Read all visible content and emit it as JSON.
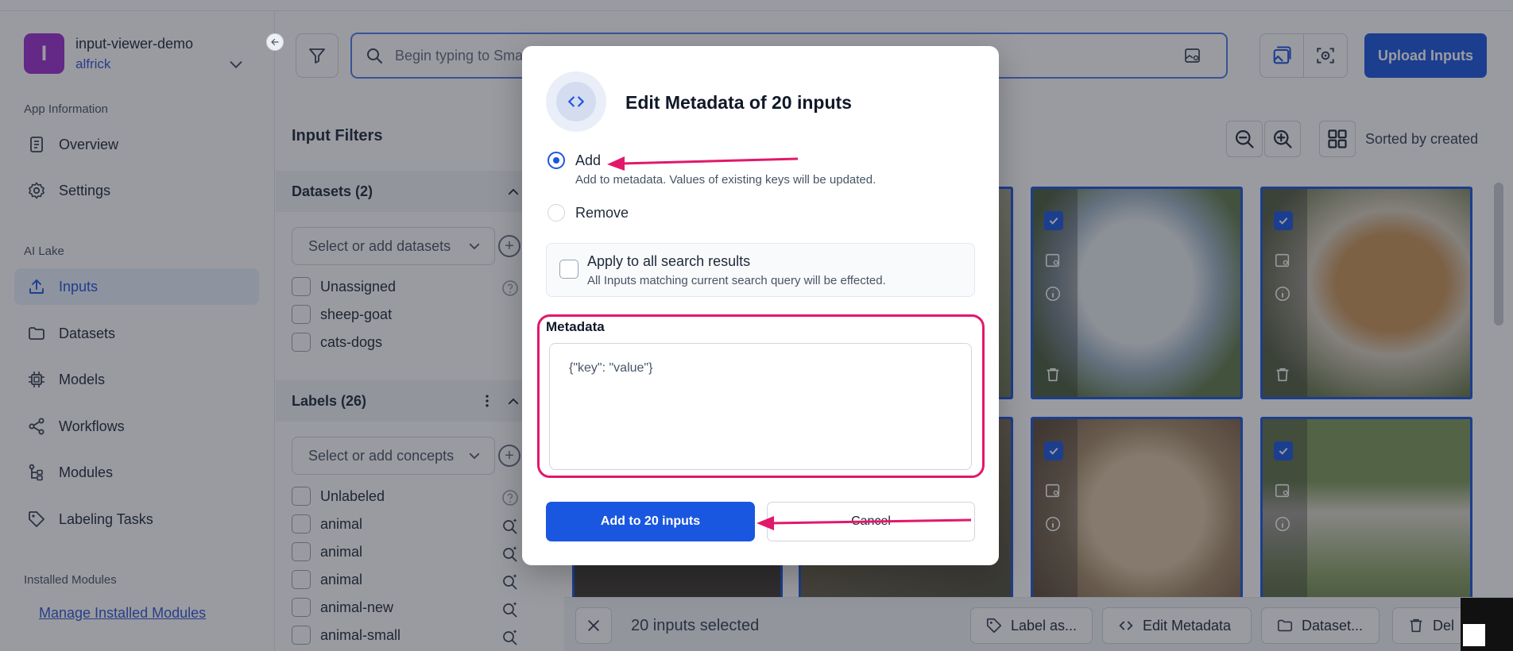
{
  "app": {
    "avatar_letter": "I",
    "name": "input-viewer-demo",
    "user": "alfrick"
  },
  "sidebar": {
    "section_app_info": "App Information",
    "overview": "Overview",
    "settings": "Settings",
    "section_ai_lake": "AI Lake",
    "inputs": "Inputs",
    "datasets": "Datasets",
    "models": "Models",
    "workflows": "Workflows",
    "modules": "Modules",
    "labeling_tasks": "Labeling Tasks",
    "section_installed": "Installed Modules",
    "manage_modules": "Manage Installed Modules"
  },
  "header": {
    "search_placeholder": "Begin typing to Smar",
    "upload_button": "Upload Inputs"
  },
  "filters": {
    "title": "Input Filters",
    "datasets_heading": "Datasets (2)",
    "datasets_select_placeholder": "Select or add datasets",
    "dataset_items": [
      "Unassigned",
      "sheep-goat",
      "cats-dogs"
    ],
    "labels_heading": "Labels (26)",
    "concepts_select_placeholder": "Select or add concepts",
    "label_items": [
      "Unlabeled",
      "animal",
      "animal",
      "animal",
      "animal-new",
      "animal-small"
    ]
  },
  "gallery": {
    "sorted_label": "Sorted by created"
  },
  "action_bar": {
    "selected_count": "20 inputs selected",
    "label_as": "Label as...",
    "edit_metadata": "Edit Metadata",
    "dataset": "Dataset...",
    "delete": "Del"
  },
  "modal": {
    "title": "Edit Metadata of 20 inputs",
    "add_label": "Add",
    "add_desc": "Add to metadata. Values of existing keys will be updated.",
    "remove_label": "Remove",
    "apply_title": "Apply to all search results",
    "apply_desc": "All Inputs matching current search query will be effected.",
    "metadata_label": "Metadata",
    "metadata_placeholder": "{\"key\": \"value\"}",
    "submit_button": "Add to 20 inputs",
    "cancel_button": "Cancel"
  },
  "colors": {
    "primary": "#1a57e0",
    "annotation": "#e2186b",
    "app_avatar": "#9d2fd0"
  }
}
